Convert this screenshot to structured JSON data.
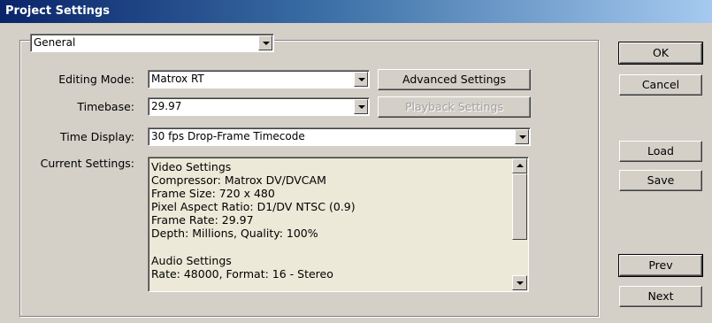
{
  "window": {
    "title": "Project Settings"
  },
  "section_select": {
    "value": "General"
  },
  "fields": {
    "editing_mode": {
      "label": "Editing Mode:",
      "value": "Matrox RT"
    },
    "timebase": {
      "label": "Timebase:",
      "value": "29.97"
    },
    "time_display": {
      "label": "Time Display:",
      "value": "30 fps Drop-Frame Timecode"
    },
    "current_settings": {
      "label": "Current Settings:"
    }
  },
  "buttons": {
    "advanced_settings": "Advanced Settings",
    "playback_settings": "Playback Settings",
    "ok": "OK",
    "cancel": "Cancel",
    "load": "Load",
    "save": "Save",
    "prev": "Prev",
    "next": "Next"
  },
  "current_settings_lines": [
    "Video Settings",
    "Compressor: Matrox DV/DVCAM",
    "Frame Size: 720 x 480",
    "Pixel Aspect Ratio: D1/DV NTSC (0.9)",
    "Frame Rate: 29.97",
    "Depth: Millions, Quality: 100%",
    "",
    "Audio Settings",
    "Rate: 48000, Format: 16 - Stereo"
  ],
  "icons": {
    "dropdown": "chevron-down-icon",
    "scroll_up": "scroll-up-arrow-icon",
    "scroll_down": "scroll-down-arrow-icon"
  },
  "colors": {
    "dialog_background": "#d4d0c8",
    "title_gradient_start": "#0a246a",
    "title_gradient_end": "#a6caf0"
  }
}
